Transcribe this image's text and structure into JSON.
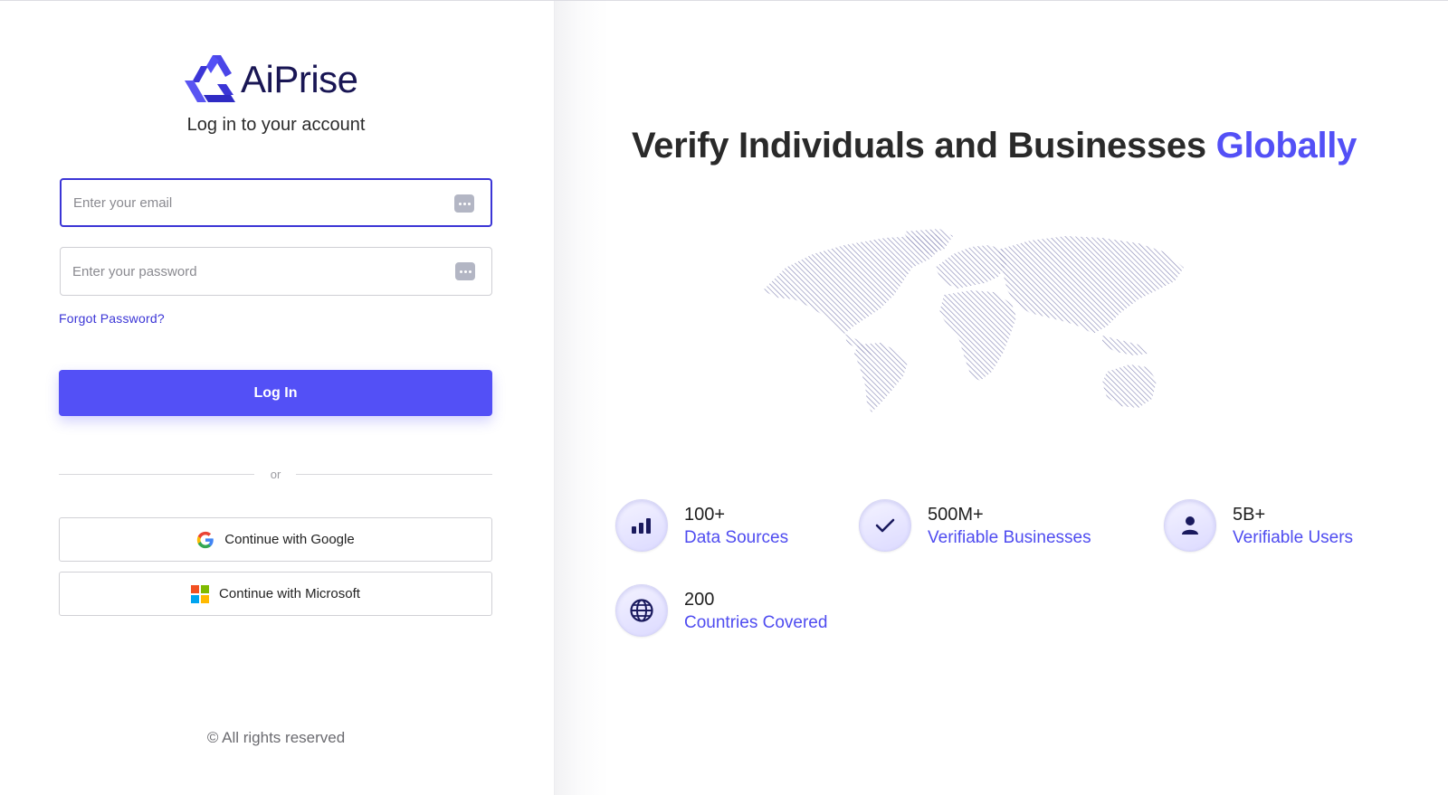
{
  "brand": {
    "name": "AiPrise",
    "logo_color": "#3b35d6"
  },
  "login": {
    "subtitle": "Log in to your account",
    "email_placeholder": "Enter your email",
    "password_placeholder": "Enter your password",
    "forgot_label": "Forgot Password?",
    "login_label": "Log In",
    "divider_label": "or",
    "google_label": "Continue with Google",
    "microsoft_label": "Continue with Microsoft",
    "footer": "© All rights reserved"
  },
  "hero": {
    "headline_prefix": "Verify Individuals and Businesses",
    "headline_accent": "Globally",
    "accent_color": "#5350f6"
  },
  "stats": [
    {
      "value": "100+",
      "label": "Data Sources",
      "icon": "bar-chart-icon"
    },
    {
      "value": "500M+",
      "label": "Verifiable Businesses",
      "icon": "checkmark-icon"
    },
    {
      "value": "5B+",
      "label": "Verifiable Users",
      "icon": "user-icon"
    },
    {
      "value": "200",
      "label": "Countries Covered",
      "icon": "globe-icon"
    }
  ]
}
